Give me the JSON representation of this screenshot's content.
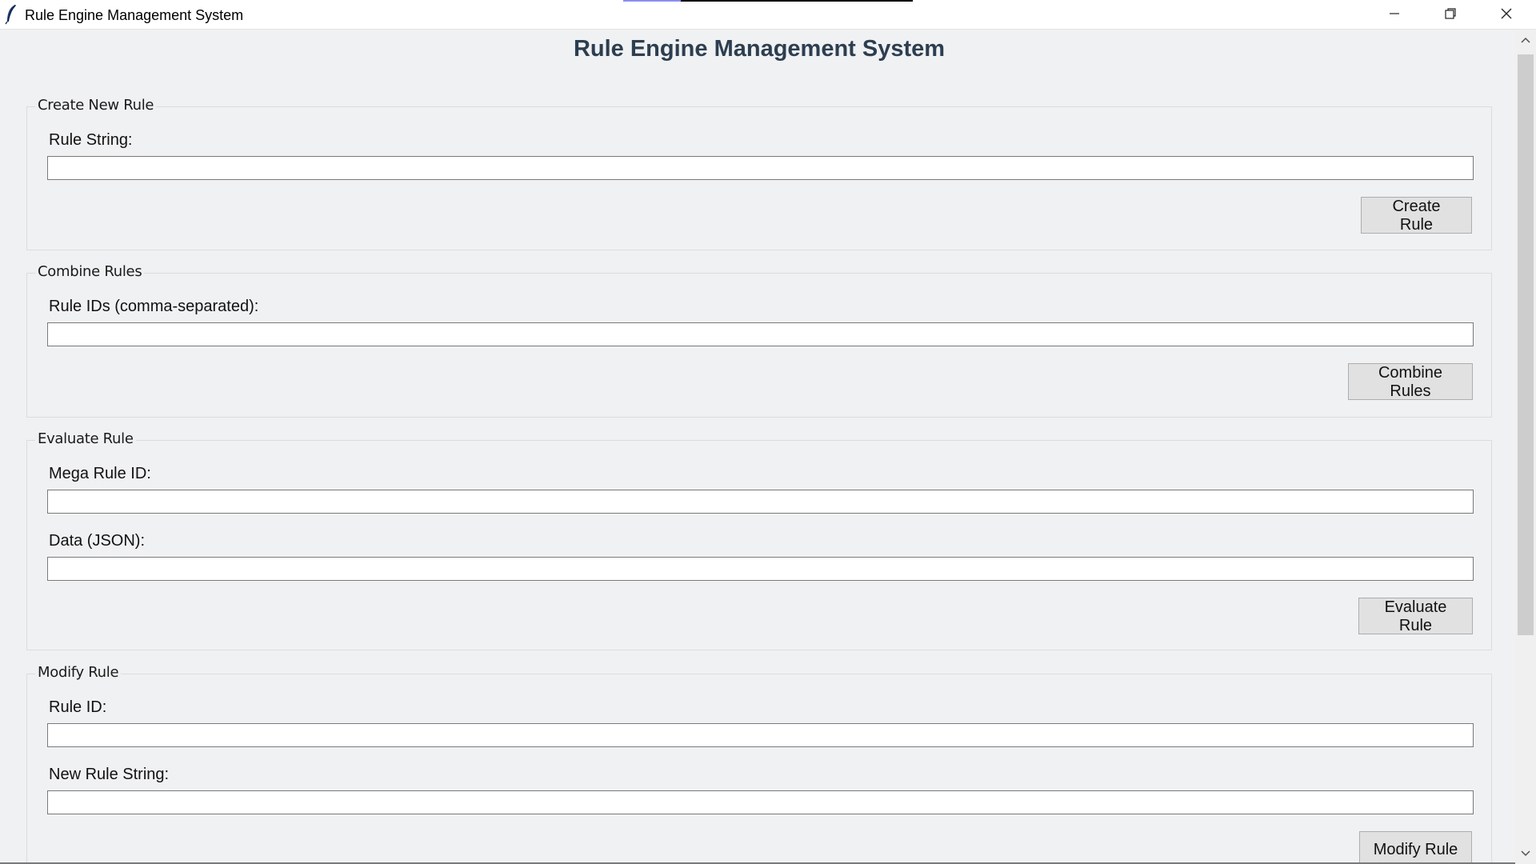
{
  "window": {
    "title": "Rule Engine Management System",
    "controls": {
      "minimize": "minimize-icon",
      "maximize": "restore-icon",
      "close": "close-icon"
    }
  },
  "header": {
    "title": "Rule Engine Management System"
  },
  "create_rule": {
    "group_title": "Create New Rule",
    "rule_string_label": "Rule String:",
    "rule_string_value": "",
    "button_label": "Create Rule"
  },
  "combine_rules": {
    "group_title": "Combine Rules",
    "rule_ids_label": "Rule IDs (comma-separated):",
    "rule_ids_value": "",
    "button_label": "Combine Rules"
  },
  "evaluate_rule": {
    "group_title": "Evaluate Rule",
    "mega_rule_id_label": "Mega Rule ID:",
    "mega_rule_id_value": "",
    "data_label": "Data (JSON):",
    "data_value": "",
    "button_label": "Evaluate Rule"
  },
  "modify_rule": {
    "group_title": "Modify Rule",
    "rule_id_label": "Rule ID:",
    "rule_id_value": "",
    "new_rule_string_label": "New Rule String:",
    "new_rule_string_value": "",
    "button_label": "Modify Rule"
  },
  "colors": {
    "heading": "#2c3e50",
    "background": "#f0f1f3",
    "button_bg": "#e1e1e1"
  }
}
